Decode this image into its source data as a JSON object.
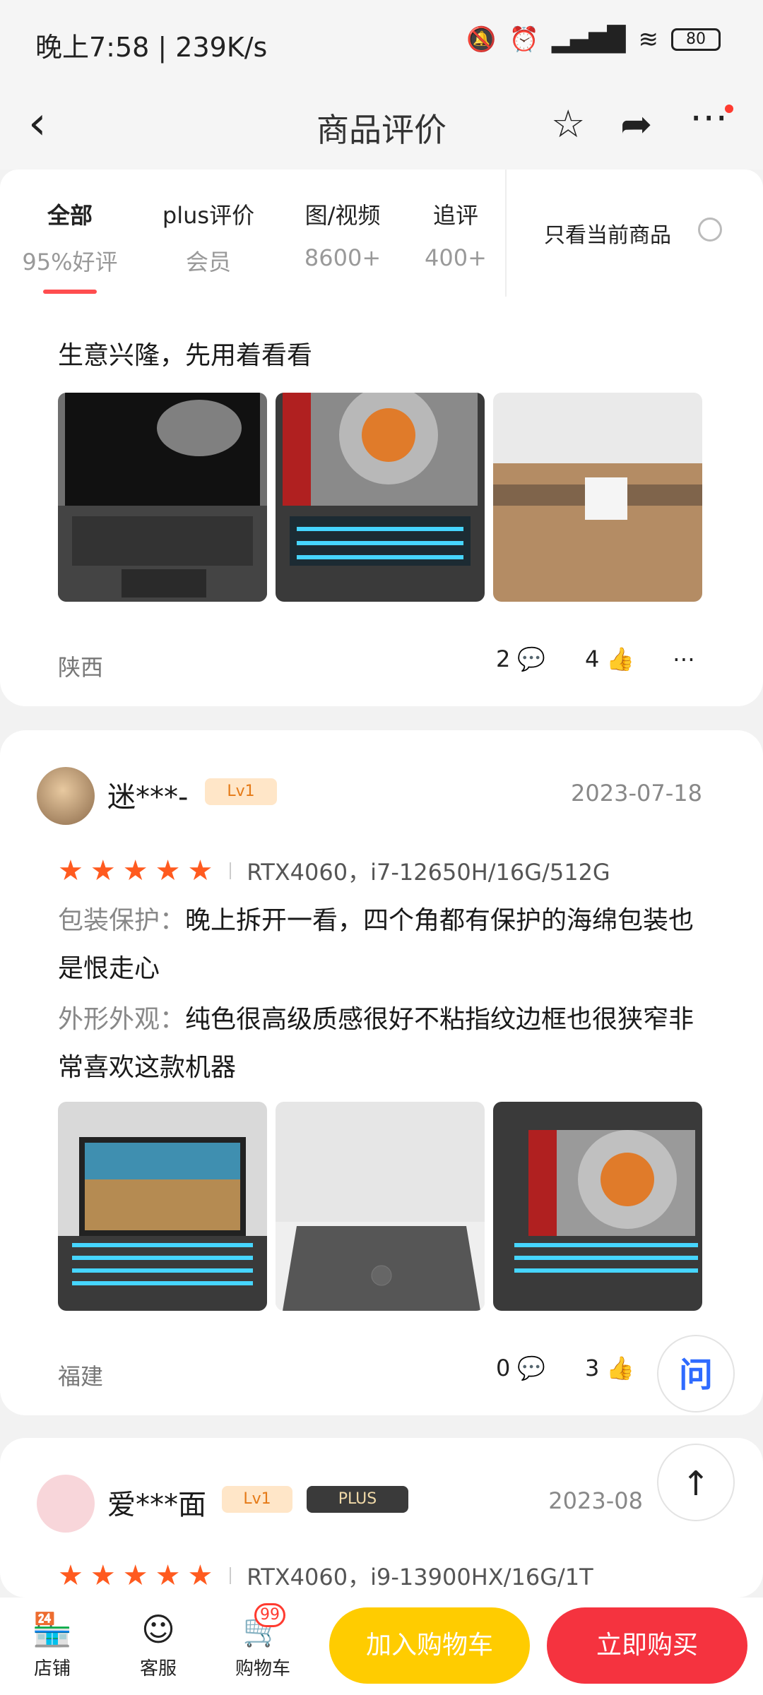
{
  "status": {
    "time": "晚上7:58 | 239K/s",
    "battery": "80"
  },
  "nav": {
    "title": "商品评价"
  },
  "tabs": [
    {
      "label": "全部",
      "sub": "95%好评"
    },
    {
      "label": "plus评价",
      "sub": "会员"
    },
    {
      "label": "图/视频",
      "sub": "8600+"
    },
    {
      "label": "追评",
      "sub": "400+"
    }
  ],
  "filter": {
    "label": "只看当前商品"
  },
  "review1": {
    "text": "生意兴隆，先用着看看",
    "location": "陕西",
    "comments": "2",
    "likes": "4"
  },
  "review2": {
    "user": "迷***-",
    "level": "Lv1",
    "date": "2023-07-18",
    "spec": "RTX4060，i7-12650H/16G/512G",
    "field1_label": "包装保护：",
    "field1_text": "晚上拆开一看，四个角都有保护的海绵包装也是恨走心",
    "field2_label": "外形外观：",
    "field2_text": "纯色很高级质感很好不粘指纹边框也很狭窄非常喜欢这款机器",
    "location": "福建",
    "comments": "0",
    "likes": "3"
  },
  "review3": {
    "user": "爱***面",
    "level": "Lv1",
    "plus": "PLUS",
    "date": "2023-08",
    "spec": "RTX4060，i9-13900HX/16G/1T"
  },
  "floats": {
    "ask": "问",
    "top": "↑"
  },
  "bottom": {
    "store": "店铺",
    "service": "客服",
    "cart": "购物车",
    "cart_count": "99",
    "add_to_cart": "加入购物车",
    "buy_now": "立即购买"
  },
  "colors": {
    "accent": "#ff4d4f",
    "star": "#ff5a1f",
    "cart_btn": "#ffcc00",
    "buy_btn": "#f5333f"
  }
}
